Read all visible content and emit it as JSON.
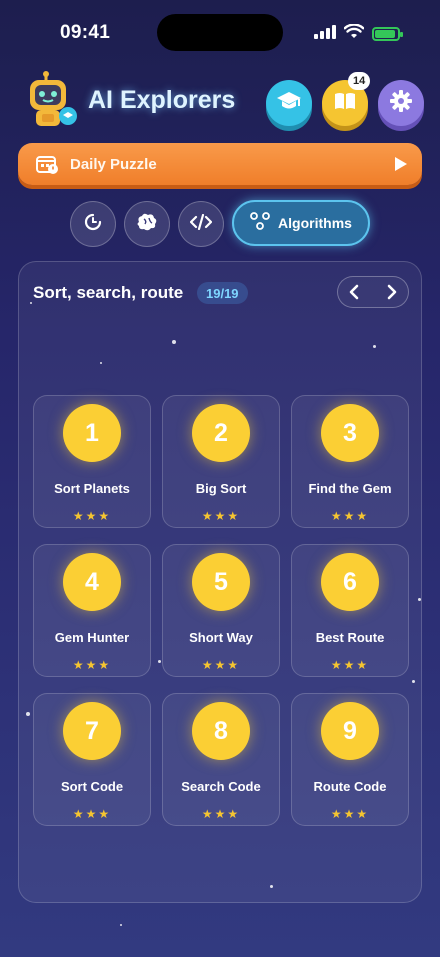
{
  "status_bar": {
    "time": "09:41"
  },
  "header": {
    "title": "AI Explorers",
    "book_badge": "14"
  },
  "daily_puzzle": {
    "label": "Daily Puzzle"
  },
  "filters": {
    "chips": [
      {
        "icon": "clock-icon"
      },
      {
        "icon": "brain-icon"
      },
      {
        "icon": "code-icon"
      }
    ],
    "active": {
      "label": "Algorithms",
      "icon": "nodes-icon"
    }
  },
  "panel": {
    "title": "Sort, search, route",
    "progress": "19/19",
    "levels": [
      {
        "number": "1",
        "name": "Sort Planets",
        "stars": "★★★"
      },
      {
        "number": "2",
        "name": "Big Sort",
        "stars": "★★★"
      },
      {
        "number": "3",
        "name": "Find the Gem",
        "stars": "★★★"
      },
      {
        "number": "4",
        "name": "Gem Hunter",
        "stars": "★★★"
      },
      {
        "number": "5",
        "name": "Short Way",
        "stars": "★★★"
      },
      {
        "number": "6",
        "name": "Best Route",
        "stars": "★★★"
      },
      {
        "number": "7",
        "name": "Sort Code",
        "stars": "★★★"
      },
      {
        "number": "8",
        "name": "Search Code",
        "stars": "★★★"
      },
      {
        "number": "9",
        "name": "Route Code",
        "stars": "★★★"
      }
    ]
  },
  "colors": {
    "accent_orange": "#f07e2a",
    "gold": "#fbcf34",
    "active_chip": "#5cc4ee",
    "battery_green": "#34c759"
  }
}
